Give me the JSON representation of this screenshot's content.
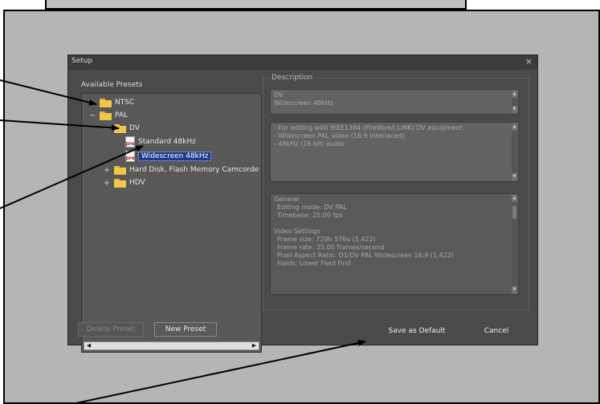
{
  "dialog": {
    "title": "Setup",
    "close_glyph": "×"
  },
  "presets": {
    "label": "Available Presets",
    "items": [
      {
        "expander": "+",
        "label": "NTSC",
        "icon": "folder-icon"
      },
      {
        "expander": "−",
        "label": "PAL",
        "icon": "folder-icon"
      },
      {
        "expander": "−",
        "label": "DV",
        "icon": "folder-icon"
      },
      {
        "label": "Standard 48kHz",
        "icon": "preset-file-icon"
      },
      {
        "label": "Widescreen 48kHz",
        "icon": "preset-file-icon",
        "selected": true
      },
      {
        "expander": "+",
        "label": "Hard Disk, Flash Memory Camcorde",
        "icon": "folder-icon"
      },
      {
        "expander": "+",
        "label": "HDV",
        "icon": "folder-icon"
      }
    ],
    "file_icon_text": "pre"
  },
  "description": {
    "legend": "Description",
    "name_lines": [
      "DV",
      "Widescreen 48kHz"
    ],
    "notes": [
      "- For editing with IEEE1394 (FireWire/i.LINK) DV equipment.",
      "- Widescreen PAL video (16:9 interlaced).",
      "- 48kHz (16 bit) audio."
    ],
    "general_title": "General",
    "general_lines": [
      "Editing mode: DV PAL",
      "Timebase: 25,00 fps"
    ],
    "video_title": "Video Settings",
    "video_lines": [
      "Frame size: 720h 576v (1,422)",
      "Frame rate: 25,00 frames/second",
      "Pixel Aspect Ratio: D1/DV PAL Widescreen 16:9 (1,422)",
      "Fields: Lower Field First"
    ]
  },
  "buttons": {
    "delete_preset": "Delete Preset",
    "new_preset": "New Preset",
    "save_default": "Save as Default",
    "cancel": "Cancel"
  }
}
